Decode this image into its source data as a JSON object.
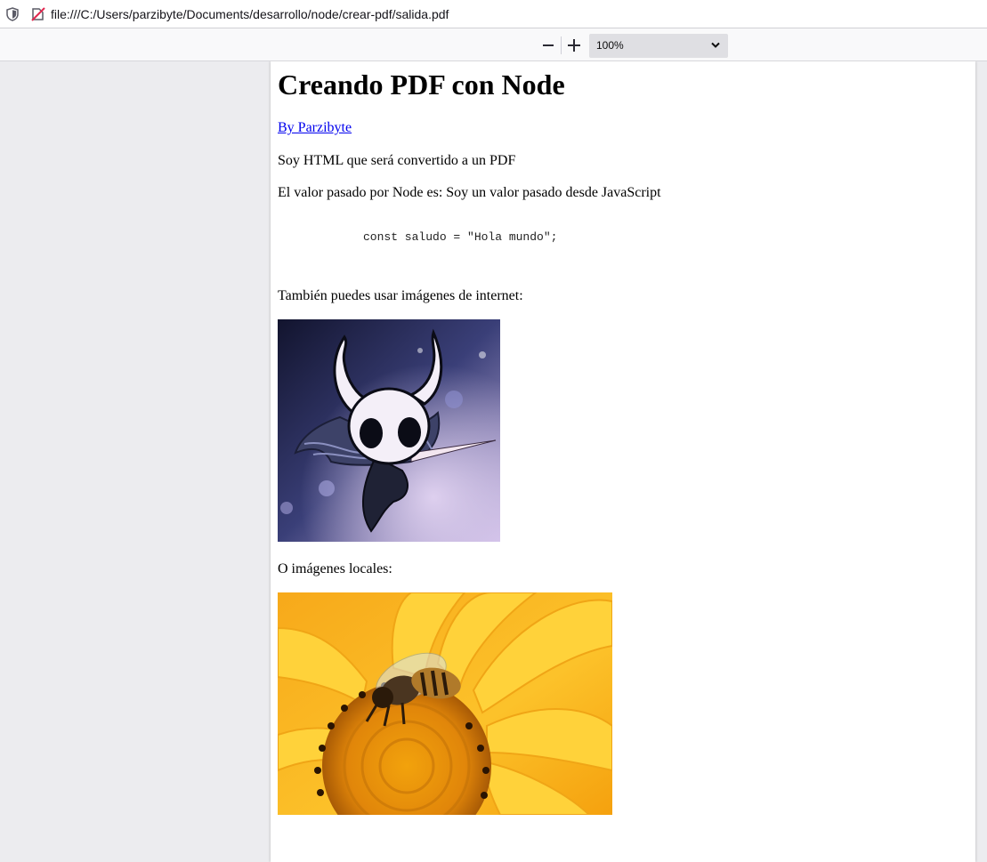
{
  "browser": {
    "url": "file:///C:/Users/parzibyte/Documents/desarrollo/node/crear-pdf/salida.pdf"
  },
  "pdf_toolbar": {
    "zoom_value": "100%",
    "icons": [
      "zoom-out-icon",
      "zoom-in-icon",
      "chevron-down-icon"
    ]
  },
  "document": {
    "title": "Creando PDF con Node",
    "author_link": "By Parzibyte",
    "paragraph_1": "Soy HTML que será convertido a un PDF",
    "paragraph_2": "El valor pasado por Node es: Soy un valor pasado desde JavaScript",
    "code": "const saludo = \"Hola mundo\";",
    "internet_images_text": "También puedes usar imágenes de internet:",
    "local_images_text": "O imágenes locales:"
  },
  "colors": {
    "link": "#0000ee",
    "viewer_background": "#ececef",
    "page_background": "#ffffff"
  }
}
